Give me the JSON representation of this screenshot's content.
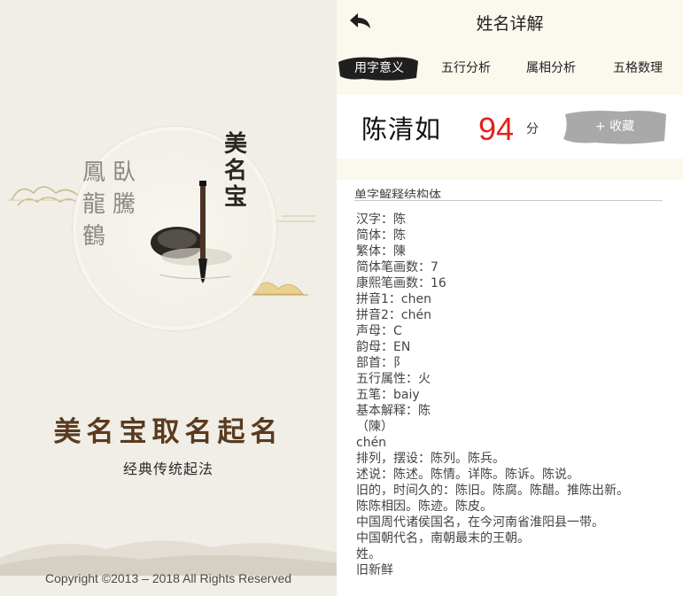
{
  "splash": {
    "logo_side_text": "鳳臥龍騰鶴",
    "logo_vertical_text": "美名宝",
    "app_title": "美名宝取名起名",
    "app_subtitle": "经典传统起法",
    "copyright": "Copyright ©2013 – 2018 All Rights Reserved"
  },
  "detail": {
    "title": "姓名详解",
    "tabs": [
      "用字意义",
      "五行分析",
      "属相分析",
      "五格数理"
    ],
    "active_tab": 0,
    "name": "陈清如",
    "score": "94",
    "score_unit": "分",
    "collect_label": "+ 收藏",
    "section_heading": "单字解释结构体",
    "lines": [
      "汉字：陈",
      "简体：陈",
      "繁体：陳",
      "简体笔画数：7",
      "康熙笔画数：16",
      "拼音1：chen",
      "拼音2：chén",
      "声母：C",
      "韵母：EN",
      "部首：阝",
      "五行属性：火",
      "五笔：baiy",
      "基本解释：陈",
      "（陳）",
      "chén",
      "排列，摆设：陈列。陈兵。",
      "述说：陈述。陈情。详陈。陈诉。陈说。",
      "旧的，时间久的：陈旧。陈腐。陈醋。推陈出新。",
      "陈陈相因。陈迹。陈皮。",
      "中国周代诸侯国名，在今河南省淮阳县一带。",
      "中国朝代名，南朝最末的王朝。",
      "姓。",
      "旧新鲜"
    ]
  },
  "colors": {
    "score_red": "#e2231a",
    "title_brown": "#5a3a1e",
    "ink_black": "#1e1e1e",
    "background_cream": "#fbf8ee"
  }
}
